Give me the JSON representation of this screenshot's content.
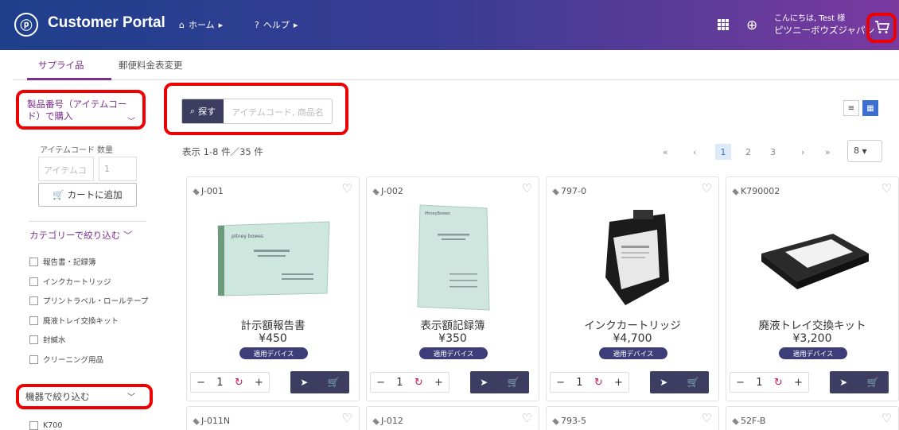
{
  "header": {
    "brand": "Customer Portal",
    "nav_home": "ホーム",
    "nav_help": "ヘルプ",
    "greeting_line1": "こんにちは, Test 様",
    "greeting_line2": "ピツニーボウズジャパン"
  },
  "tabs": [
    {
      "label": "サプライ品",
      "active": true
    },
    {
      "label": "郵便料金表変更",
      "active": false
    }
  ],
  "sidebar": {
    "product_number_dropdown": "製品番号（アイテムコード）で購入",
    "item_code_label": "アイテムコード",
    "quantity_label": "数量",
    "item_code_placeholder": "アイテムコ",
    "quantity_value": "1",
    "add_to_cart": "カートに追加",
    "category_filter": "カテゴリーで絞り込む",
    "categories": [
      "報告書・記録簿",
      "インクカートリッジ",
      "プリントラベル・ロールテープ",
      "廃液トレイ交換キット",
      "封緘水",
      "クリーニング用品"
    ],
    "device_filter": "機器で絞り込む",
    "devices": [
      "K700"
    ]
  },
  "search": {
    "button_label": "探す",
    "placeholder": "アイテムコード, 商品名"
  },
  "results": {
    "count_text": "表示 1-8 件／35 件",
    "pages": [
      "1",
      "2",
      "3"
    ],
    "current_page": "1",
    "per_page": "8"
  },
  "products": [
    {
      "code": "J-001",
      "name": "計示額報告書",
      "price": "¥450",
      "badge": "適用デバイス",
      "qty": "1",
      "image": "green-report-book"
    },
    {
      "code": "J-002",
      "name": "表示額記録簿",
      "price": "¥350",
      "badge": "適用デバイス",
      "qty": "1",
      "image": "green-record-book"
    },
    {
      "code": "797-0",
      "name": "インクカートリッジ",
      "price": "¥4,700",
      "badge": "適用デバイス",
      "qty": "1",
      "image": "ink-cartridge"
    },
    {
      "code": "K790002",
      "name": "廃液トレイ交換キット",
      "price": "¥3,200",
      "badge": "適用デバイス",
      "qty": "1",
      "image": "waste-tray-kit"
    }
  ],
  "products_row2": [
    {
      "code": "J-011N"
    },
    {
      "code": "J-012"
    },
    {
      "code": "793-5"
    },
    {
      "code": "52F-B"
    }
  ],
  "colors": {
    "accent": "#7b2e8f",
    "button_dark": "#3d3d62",
    "highlight_red": "#ee0000"
  }
}
